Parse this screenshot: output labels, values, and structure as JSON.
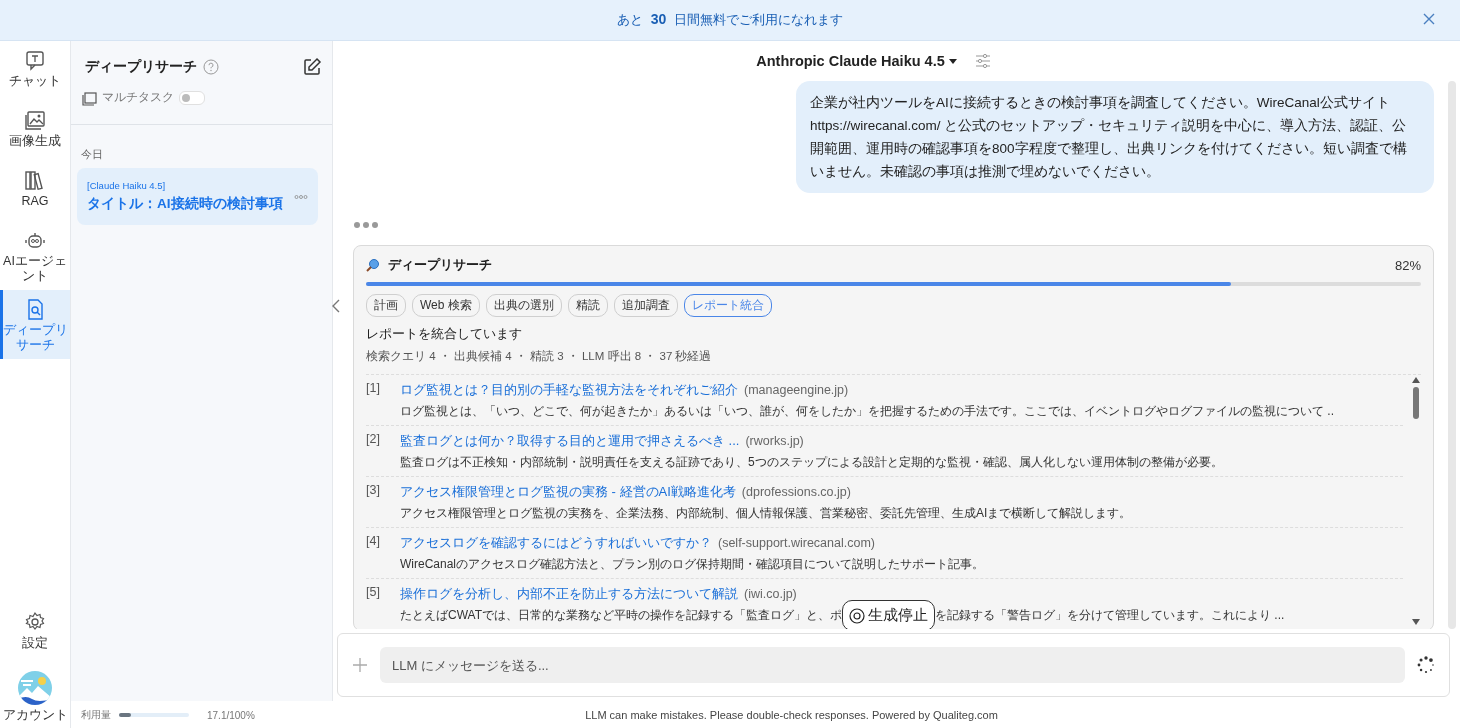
{
  "banner": {
    "text": "あと **30** 日間無料でご利用になれます"
  },
  "rail": {
    "items": [
      {
        "label": "チャット",
        "selected": false
      },
      {
        "label": "画像生成",
        "selected": false
      },
      {
        "label": "RAG",
        "selected": false
      },
      {
        "label": "AIエージェント",
        "selected": false
      },
      {
        "label": "ディープリサーチ",
        "selected": true
      }
    ],
    "settings": "設定",
    "account": "アカウント"
  },
  "sidebar": {
    "title": "ディープリサーチ",
    "multitask": {
      "label": "マルチタスク",
      "on": false
    },
    "group": "今日",
    "history": [
      {
        "model": "[Claude Haiku 4.5]",
        "title": "タイトル：AI接続時の検討事項",
        "selected": true
      }
    ]
  },
  "usage": {
    "label": "利用量",
    "level": 0.171,
    "reading": "17.1/100%"
  },
  "chat": {
    "model": "Anthropic Claude Haiku 4.5",
    "user_message": "企業が社内ツールをAIに接続するときの検討事項を調査してください。WireCanal公式サイト https://wirecanal.com/ と公式のセットアップ・セキュリティ説明を中心に、導入方法、認証、公開範囲、運用時の確認事項を800字程度で整理し、出典リンクを付けてください。短い調査で構いません。未確認の事項は推測で埋めないでください。",
    "research": {
      "title": "ディープリサーチ",
      "level": 0.82,
      "percent": "82%",
      "steps": [
        {
          "label": "計画",
          "selected": false
        },
        {
          "label": "Web 検索",
          "selected": false
        },
        {
          "label": "出典の選別",
          "selected": false
        },
        {
          "label": "精読",
          "selected": false
        },
        {
          "label": "追加調査",
          "selected": false
        },
        {
          "label": "レポート統合",
          "selected": true
        }
      ],
      "status": "レポートを統合しています",
      "stats": "検索クエリ 4 ・ 出典候補 4 ・ 精読 3 ・ LLM 呼出 8 ・ 37 秒経過",
      "sources": [
        {
          "index": "[1]",
          "title": "ログ監視とは？目的別の手軽な監視方法をそれぞれご紹介",
          "domain": "(manageengine.jp)",
          "snippet": "ログ監視とは、「いつ、どこで、何が起きたか」あるいは「いつ、誰が、何をしたか」を把握するための手法です。ここでは、イベントログやログファイルの監視について .."
        },
        {
          "index": "[2]",
          "title": "監査ログとは何か？取得する目的と運用で押さえるべき ...",
          "domain": "(rworks.jp)",
          "snippet": "監査ログは不正検知・内部統制・説明責任を支える証跡であり、5つのステップによる設計と定期的な監視・確認、属人化しない運用体制の整備が必要。"
        },
        {
          "index": "[3]",
          "title": "アクセス権限管理とログ監視の実務 - 経営のAI戦略進化考",
          "domain": "(dprofessions.co.jp)",
          "snippet": "アクセス権限管理とログ監視の実務を、企業法務、内部統制、個人情報保護、営業秘密、委託先管理、生成AIまで横断して解説します。"
        },
        {
          "index": "[4]",
          "title": "アクセスログを確認するにはどうすればいいですか？",
          "domain": "(self-support.wirecanal.com)",
          "snippet": "WireCanalのアクセスログ確認方法と、プラン別のログ保持期間・確認項目について説明したサポート記事。"
        },
        {
          "index": "[5]",
          "title": "操作ログを分析し、内部不正を防止する方法について解説",
          "domain": "(iwi.co.jp)",
          "snippet": "たとえばCWATでは、日常的な業務など平時の操作を記録する「監査ログ」と、ポ",
          "snippet_after": "を記録する「警告ログ」を分けて管理しています。これにより ..."
        }
      ]
    },
    "stop_button": "生成停止",
    "input": {
      "placeholder": "LLM にメッセージを送る..."
    }
  },
  "disclaimer": "LLM can make mistakes. Please double-check responses. Powered by Qualiteg.com"
}
